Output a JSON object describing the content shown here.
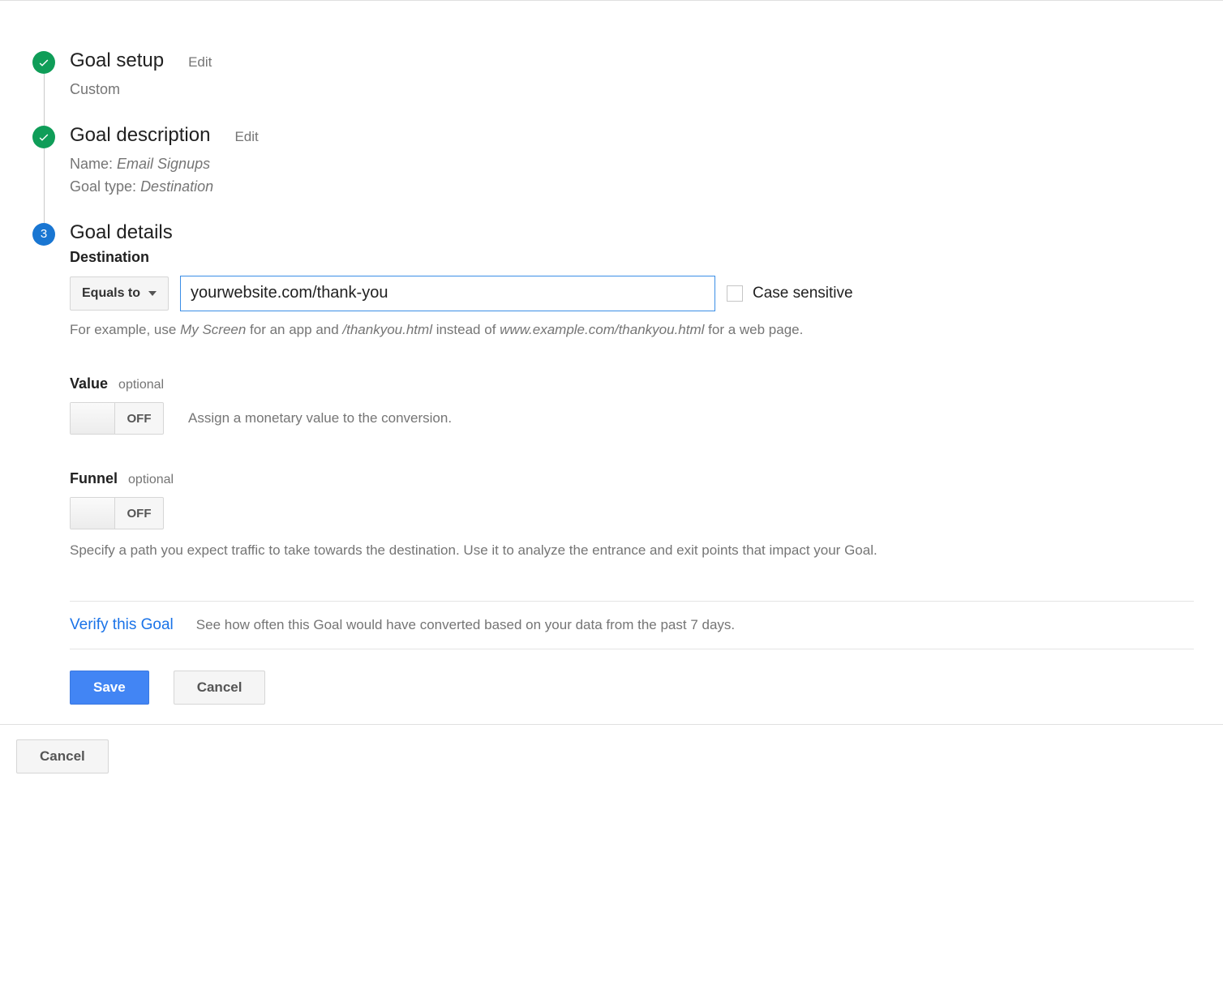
{
  "steps": {
    "setup": {
      "title": "Goal setup",
      "edit": "Edit",
      "sub": "Custom"
    },
    "description": {
      "title": "Goal description",
      "edit": "Edit",
      "name_label": "Name:",
      "name_value": "Email Signups",
      "type_label": "Goal type:",
      "type_value": "Destination"
    },
    "details": {
      "number": "3",
      "title": "Goal details"
    }
  },
  "destination": {
    "label": "Destination",
    "match_type": "Equals to",
    "input_value": "yourwebsite.com/thank-you",
    "case_label": "Case sensitive",
    "help_prefix": "For example, use ",
    "help_italic1": "My Screen",
    "help_mid1": " for an app and ",
    "help_italic2": "/thankyou.html",
    "help_mid2": " instead of ",
    "help_italic3": "www.example.com/thankyou.html",
    "help_suffix": " for a web page."
  },
  "value": {
    "label": "Value",
    "optional": "optional",
    "toggle": "OFF",
    "desc": "Assign a monetary value to the conversion."
  },
  "funnel": {
    "label": "Funnel",
    "optional": "optional",
    "toggle": "OFF",
    "desc": "Specify a path you expect traffic to take towards the destination. Use it to analyze the entrance and exit points that impact your Goal."
  },
  "verify": {
    "link": "Verify this Goal",
    "desc": "See how often this Goal would have converted based on your data from the past 7 days."
  },
  "buttons": {
    "save": "Save",
    "cancel_inner": "Cancel",
    "cancel_outer": "Cancel"
  }
}
